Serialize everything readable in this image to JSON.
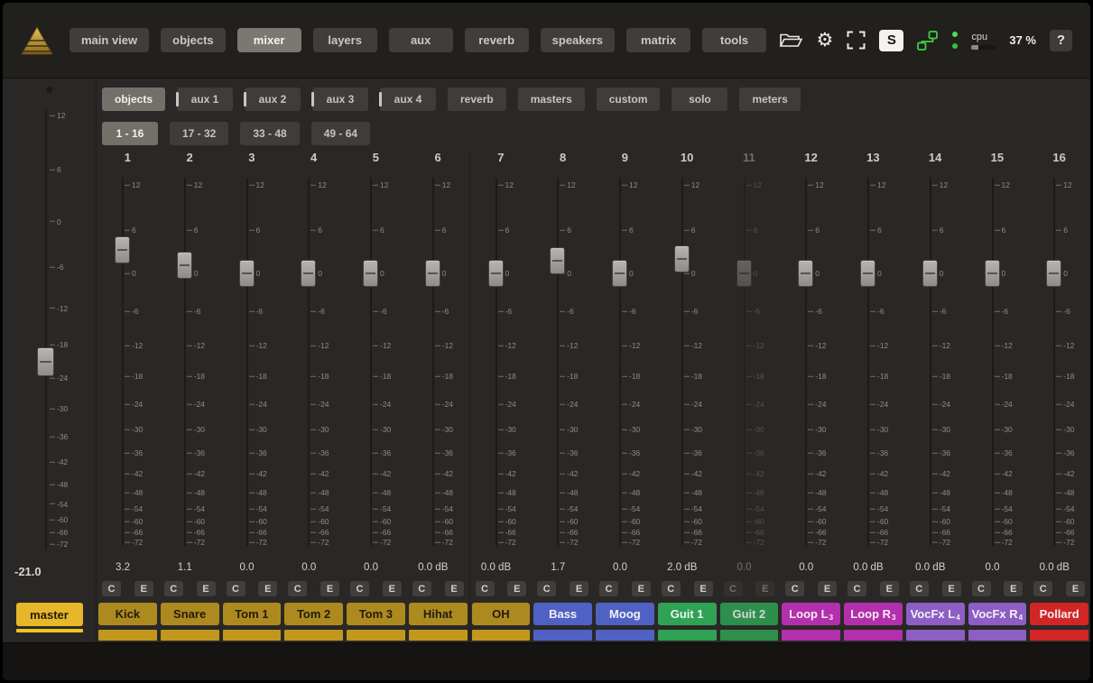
{
  "header": {
    "nav": [
      {
        "label": "main view",
        "active": false
      },
      {
        "label": "objects",
        "active": false
      },
      {
        "label": "mixer",
        "active": true
      },
      {
        "label": "layers",
        "active": false
      },
      {
        "label": "aux",
        "active": false
      },
      {
        "label": "reverb",
        "active": false
      },
      {
        "label": "speakers",
        "active": false
      },
      {
        "label": "matrix",
        "active": false
      },
      {
        "label": "tools",
        "active": false
      }
    ],
    "solo_button": "S",
    "cpu": {
      "label": "cpu",
      "percent_text": "37 %",
      "meter_fraction": 0.3
    },
    "help_button": "?"
  },
  "view_tabs": [
    {
      "label": "objects",
      "active": true,
      "tick": false
    },
    {
      "label": "aux 1",
      "active": false,
      "tick": true
    },
    {
      "label": "aux 2",
      "active": false,
      "tick": true
    },
    {
      "label": "aux 3",
      "active": false,
      "tick": true
    },
    {
      "label": "aux 4",
      "active": false,
      "tick": true
    },
    {
      "label": "reverb",
      "active": false,
      "tick": false
    },
    {
      "label": "masters",
      "active": false,
      "tick": false
    },
    {
      "label": "custom",
      "active": false,
      "tick": false
    },
    {
      "label": "solo",
      "active": false,
      "tick": false
    },
    {
      "label": "meters",
      "active": false,
      "tick": false
    }
  ],
  "bank_tabs": [
    {
      "label": "1 - 16",
      "active": true
    },
    {
      "label": "17 - 32",
      "active": false
    },
    {
      "label": "33 - 48",
      "active": false
    },
    {
      "label": "49 - 64",
      "active": false
    }
  ],
  "fader_scale": [
    "12",
    "6",
    "0",
    "-6",
    "-12",
    "-18",
    "-24",
    "-30",
    "-36",
    "-42",
    "-48",
    "-54",
    "-60",
    "-66",
    "-72"
  ],
  "buttons": {
    "c": "C",
    "e": "E"
  },
  "master": {
    "label": "master",
    "value": -21,
    "display": "-21.0"
  },
  "colors": {
    "gold": {
      "bg": "#ad8a1f",
      "text": "#221c0c",
      "bar": "#c2981c"
    },
    "blue": {
      "bg": "#4f62c4",
      "text": "#f2f1f5",
      "bar": "#4f62c4"
    },
    "green": {
      "bg": "#2fa254",
      "text": "#eef6f0",
      "bar": "#2fa254"
    },
    "magenta": {
      "bg": "#b32fac",
      "text": "#f7eef6",
      "bar": "#b32fac"
    },
    "purple": {
      "bg": "#8d5ec4",
      "text": "#f4f0f8",
      "bar": "#8d5ec4"
    },
    "red": {
      "bg": "#d22525",
      "text": "#f8efef",
      "bar": "#d22525"
    },
    "master_label": {
      "bg": "#e6b62b",
      "text": "#221c0c",
      "bar": "#f2c21e"
    }
  },
  "channels": [
    {
      "num": "1",
      "name": "Kick",
      "sub": "",
      "color": "gold",
      "value": 3.2,
      "display": "3.2",
      "dim": false
    },
    {
      "num": "2",
      "name": "Snare",
      "sub": "",
      "color": "gold",
      "value": 1.1,
      "display": "1.1",
      "dim": false
    },
    {
      "num": "3",
      "name": "Tom 1",
      "sub": "",
      "color": "gold",
      "value": 0.0,
      "display": "0.0",
      "dim": false
    },
    {
      "num": "4",
      "name": "Tom 2",
      "sub": "",
      "color": "gold",
      "value": 0.0,
      "display": "0.0",
      "dim": false
    },
    {
      "num": "5",
      "name": "Tom 3",
      "sub": "",
      "color": "gold",
      "value": 0.0,
      "display": "0.0",
      "dim": false
    },
    {
      "num": "6",
      "name": "Hihat",
      "sub": "",
      "color": "gold",
      "value": 0.0,
      "display": "0.0 dB",
      "dim": false
    },
    {
      "num": "7",
      "name": "OH",
      "sub": "",
      "color": "gold",
      "value": 0.0,
      "display": "0.0 dB",
      "dim": false
    },
    {
      "num": "8",
      "name": "Bass",
      "sub": "",
      "color": "blue",
      "value": 1.7,
      "display": "1.7",
      "dim": false
    },
    {
      "num": "9",
      "name": "Moog",
      "sub": "",
      "color": "blue",
      "value": 0.0,
      "display": "0.0",
      "dim": false
    },
    {
      "num": "10",
      "name": "Guit 1",
      "sub": "",
      "color": "green",
      "value": 2.0,
      "display": "2.0 dB",
      "dim": false
    },
    {
      "num": "11",
      "name": "Guit 2",
      "sub": "",
      "color": "green",
      "value": 0.0,
      "display": "0.0",
      "dim": true
    },
    {
      "num": "12",
      "name": "Loop L",
      "sub": "3",
      "color": "magenta",
      "value": 0.0,
      "display": "0.0",
      "dim": false
    },
    {
      "num": "13",
      "name": "Loop R",
      "sub": "3",
      "color": "magenta",
      "value": 0.0,
      "display": "0.0 dB",
      "dim": false
    },
    {
      "num": "14",
      "name": "VocFx L",
      "sub": "4",
      "color": "purple",
      "value": 0.0,
      "display": "0.0 dB",
      "dim": false
    },
    {
      "num": "15",
      "name": "VocFx R",
      "sub": "4",
      "color": "purple",
      "value": 0.0,
      "display": "0.0",
      "dim": false
    },
    {
      "num": "16",
      "name": "Pollard",
      "sub": "",
      "color": "red",
      "value": 0.0,
      "display": "0.0 dB",
      "dim": false
    }
  ]
}
